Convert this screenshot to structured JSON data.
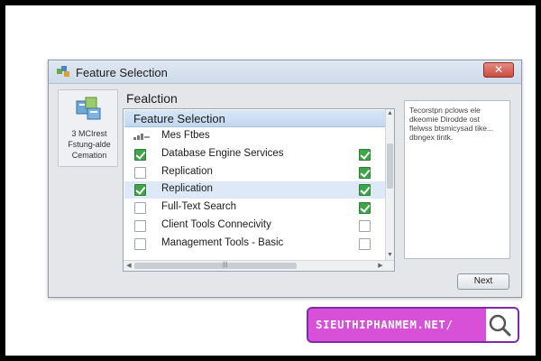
{
  "window": {
    "title": "Feature Selection",
    "close_label": "✕"
  },
  "left_panel": {
    "lines": [
      "3 MCIrest",
      "Fstung-alde",
      "Cemation"
    ]
  },
  "section": {
    "title": "Fealction"
  },
  "feature_list": {
    "header": "Feature Selection",
    "rows": [
      {
        "label": "Mes Ftbes",
        "checked": null,
        "checked2": null,
        "icon": "small-bars-icon"
      },
      {
        "label": "Database Engine Services",
        "checked": true,
        "checked2": true
      },
      {
        "label": "Replication",
        "checked": false,
        "checked2": true
      },
      {
        "label": "Replication",
        "checked": true,
        "checked2": true,
        "selected": true
      },
      {
        "label": "Full-Text Search",
        "checked": false,
        "checked2": true
      },
      {
        "label": "Client Tools Connecivity",
        "checked": false,
        "checked2": false
      },
      {
        "label": "Management Tools - Basic",
        "checked": false,
        "checked2": false
      }
    ]
  },
  "description": {
    "lines": [
      "Tecorstpn pclows ele",
      "dkeomie Dirodde ost",
      "flelwss btsmicysad tike...",
      "dbngex tintk."
    ]
  },
  "buttons": {
    "next": "Next"
  },
  "watermark": {
    "text": "SIEUTHIPHANMEM.NET/",
    "icon": "search-icon"
  },
  "colors": {
    "check_green": "#3fa44a",
    "selection": "#dde9f6",
    "header_blue": "#c2d8f0",
    "watermark": "#d84fd8"
  }
}
